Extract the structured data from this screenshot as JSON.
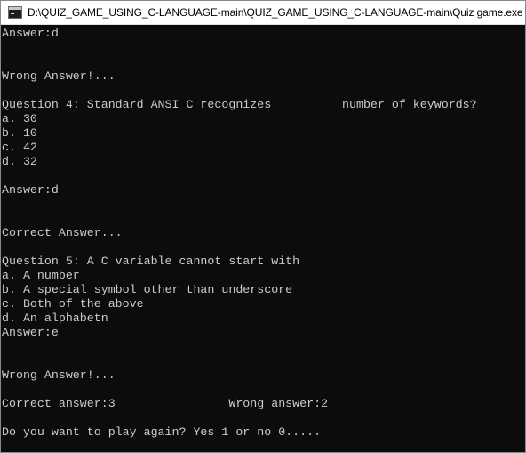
{
  "window": {
    "title": "D:\\QUIZ_GAME_USING_C-LANGUAGE-main\\QUIZ_GAME_USING_C-LANGUAGE-main\\Quiz game.exe"
  },
  "console": {
    "lines": [
      "Answer:d",
      "",
      "",
      "Wrong Answer!...",
      "",
      "Question 4: Standard ANSI C recognizes ________ number of keywords?",
      "a. 30",
      "b. 10",
      "c. 42",
      "d. 32",
      "",
      "Answer:d",
      "",
      "",
      "Correct Answer...",
      "",
      "Question 5: A C variable cannot start with",
      "a. A number",
      "b. A special symbol other than underscore",
      "c. Both of the above",
      "d. An alphabetn",
      "Answer:e",
      "",
      "",
      "Wrong Answer!...",
      "",
      "Correct answer:3                Wrong answer:2",
      "",
      "Do you want to play again? Yes 1 or no 0....."
    ]
  }
}
